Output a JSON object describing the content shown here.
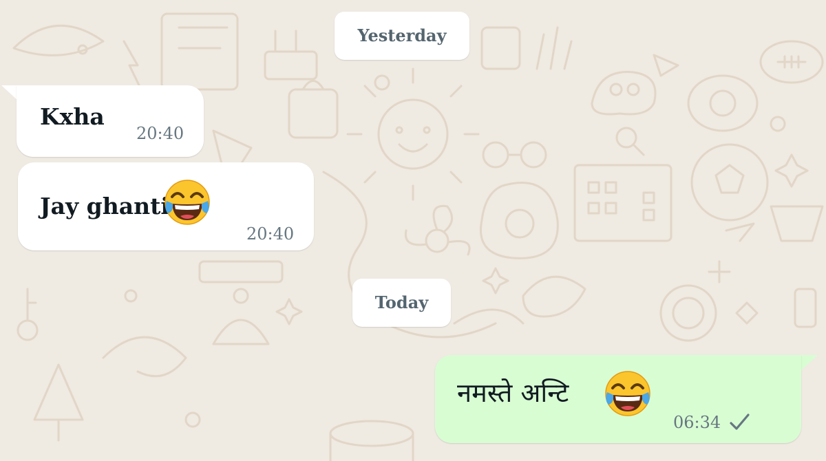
{
  "date_separators": {
    "yesterday": "Yesterday",
    "today": "Today"
  },
  "messages": [
    {
      "direction": "incoming",
      "text": "Kxha",
      "time": "20:40"
    },
    {
      "direction": "incoming",
      "text": "Jay ghanti",
      "emoji": "face-with-tears-of-joy-icon",
      "time": "20:40"
    },
    {
      "direction": "outgoing",
      "text": "नमस्ते अन्टि",
      "emoji": "face-with-tears-of-joy-icon",
      "time": "06:34",
      "status": "single-check-icon"
    }
  ],
  "colors": {
    "wallpaper": "#efeae2",
    "doodle": "#e2d8cb",
    "incoming_bubble": "#ffffff",
    "outgoing_bubble": "#d9fdd3",
    "text": "#111b21",
    "timestamp": "#667781"
  }
}
